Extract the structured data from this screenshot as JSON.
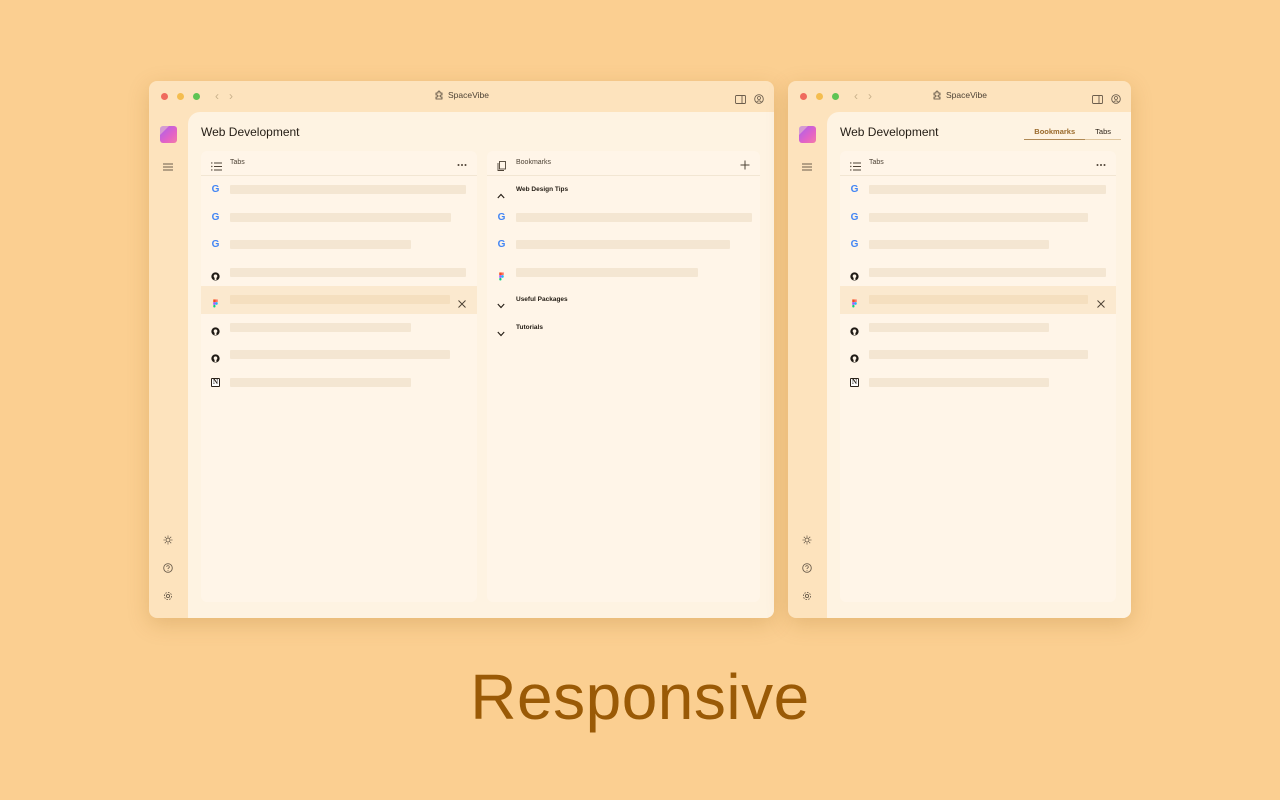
{
  "colors": {
    "background": "#fbcf91",
    "window": "#fde3bd",
    "content": "#fef3e2",
    "panel": "#fff5e8",
    "caption": "#9a5a06",
    "accent": "#9a6a2c",
    "placeholder_bar": "#f4e6d2",
    "active_row": "#fbe9cf"
  },
  "app": {
    "title": "SpaceVibe"
  },
  "workspace": {
    "title": "Web Development"
  },
  "tabs_panel": {
    "title": "Tabs",
    "header_icon": "list-icon",
    "action_icon": "more-horizontal-icon",
    "items": [
      {
        "icon": "google-icon",
        "active": false
      },
      {
        "icon": "google-icon",
        "active": false
      },
      {
        "icon": "google-icon",
        "active": false
      },
      {
        "icon": "github-icon",
        "active": false
      },
      {
        "icon": "figma-icon",
        "active": true,
        "trailing_icon": "close-icon"
      },
      {
        "icon": "github-icon",
        "active": false
      },
      {
        "icon": "github-icon",
        "active": false
      },
      {
        "icon": "notion-icon",
        "active": false
      }
    ]
  },
  "bookmarks_panel": {
    "title": "Bookmarks",
    "header_icon": "bookmarks-icon",
    "action_icon": "plus-icon",
    "groups": [
      {
        "title": "Web Design Tips",
        "expanded": true,
        "chevron": "chevron-up-icon",
        "items": [
          {
            "icon": "google-icon"
          },
          {
            "icon": "google-icon"
          },
          {
            "icon": "figma-icon"
          }
        ]
      },
      {
        "title": "Useful Packages",
        "expanded": false,
        "chevron": "chevron-down-icon",
        "items": []
      },
      {
        "title": "Tutorials",
        "expanded": false,
        "chevron": "chevron-down-icon",
        "items": []
      }
    ]
  },
  "segmented_control": {
    "options": [
      "Bookmarks",
      "Tabs"
    ],
    "selected": "Bookmarks"
  },
  "sidebar_icons": [
    "menu-icon",
    "sun-icon",
    "help-icon",
    "settings-icon"
  ],
  "caption": "Responsive"
}
